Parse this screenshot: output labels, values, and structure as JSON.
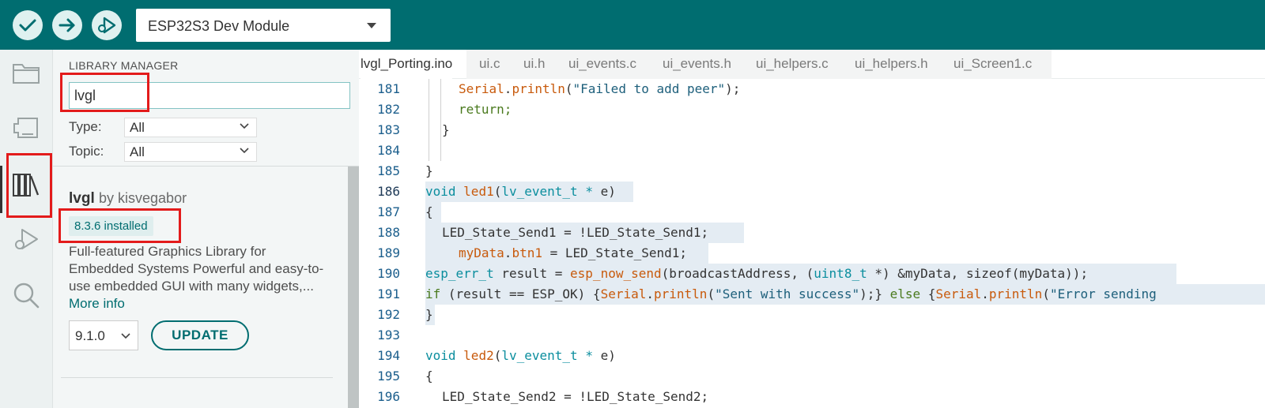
{
  "toolbar": {
    "verify_icon": "check-circle-icon",
    "upload_icon": "arrow-right-circle-icon",
    "debug_icon": "debug-play-icon",
    "board_select": "ESP32S3 Dev Module"
  },
  "activity_bar": {
    "items": [
      "folder-icon",
      "board-manager-icon",
      "library-manager-icon",
      "debug-icon",
      "search-icon"
    ],
    "active_index": 2
  },
  "library_manager": {
    "title": "LIBRARY MANAGER",
    "search_value": "lvgl",
    "type_label": "Type:",
    "type_value": "All",
    "topic_label": "Topic:",
    "topic_value": "All",
    "library": {
      "name": "lvgl",
      "author": "by kisvegabor",
      "installed_badge": "8.3.6 installed",
      "description": "Full-featured Graphics Library for Embedded Systems Powerful and easy-to-use embedded GUI with many widgets,...",
      "more_info": "More info",
      "version": "9.1.0",
      "update_label": "UPDATE"
    }
  },
  "editor": {
    "tabs": [
      "lvgl_Porting.ino",
      "ui.c",
      "ui.h",
      "ui_events.c",
      "ui_events.h",
      "ui_helpers.c",
      "ui_helpers.h",
      "ui_Screen1.c"
    ],
    "active_tab": 0,
    "lines": [
      {
        "n": "181",
        "text": "Serial.println(\"Failed to add peer\");"
      },
      {
        "n": "182",
        "text": "return;"
      },
      {
        "n": "183",
        "text": "}"
      },
      {
        "n": "184",
        "text": ""
      },
      {
        "n": "185",
        "text": "}"
      },
      {
        "n": "186",
        "text": "void led1(lv_event_t * e)"
      },
      {
        "n": "187",
        "text": "{"
      },
      {
        "n": "188",
        "text": "LED_State_Send1 = !LED_State_Send1;"
      },
      {
        "n": "189",
        "text": "myData.btn1 = LED_State_Send1;"
      },
      {
        "n": "190",
        "text": "esp_err_t result = esp_now_send(broadcastAddress, (uint8_t *) &myData, sizeof(myData));"
      },
      {
        "n": "191",
        "text": "if (result == ESP_OK) {Serial.println(\"Sent with success\");} else {Serial.println(\"Error sending"
      },
      {
        "n": "192",
        "text": "}"
      },
      {
        "n": "193",
        "text": ""
      },
      {
        "n": "194",
        "text": "void led2(lv_event_t * e)"
      },
      {
        "n": "195",
        "text": "{"
      },
      {
        "n": "196",
        "text": "LED_State_Send2 = !LED_State_Send2;"
      }
    ]
  },
  "colors": {
    "toolbar": "#006d70",
    "accent": "#006d70",
    "highlight_box": "#e31b1b",
    "selection": "#e4ecf3"
  }
}
